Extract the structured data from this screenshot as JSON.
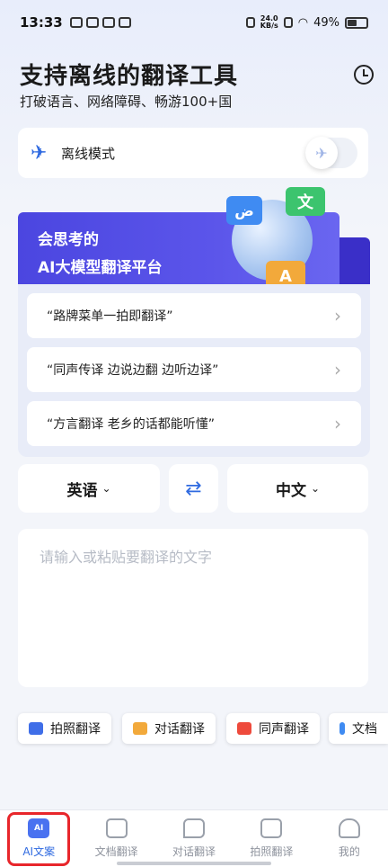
{
  "status": {
    "time": "13:33",
    "net_speed": "24.0\nKB/s",
    "battery": "49%"
  },
  "header": {
    "title": "支持离线的翻译工具",
    "subtitle": "打破语言、网络障碍、畅游100+国"
  },
  "offline": {
    "label": "离线模式"
  },
  "banner": {
    "line1": "会思考的",
    "line2": "AI大模型翻译平台",
    "bubble1": "ض",
    "bubble2": "文",
    "bubble3": "A"
  },
  "suggestions": [
    {
      "text": "“路牌菜单一拍即翻译”"
    },
    {
      "text": "“同声传译 边说边翻 边听边译”"
    },
    {
      "text": "“方言翻译 老乡的话都能听懂”"
    }
  ],
  "languages": {
    "source": "英语",
    "target": "中文"
  },
  "input": {
    "placeholder": "请输入或粘贴要翻译的文字"
  },
  "chips": [
    {
      "label": "拍照翻译",
      "icon": "camera-icon",
      "color": "#3f6ee8"
    },
    {
      "label": "对话翻译",
      "icon": "chat-icon",
      "color": "#f2a93b"
    },
    {
      "label": "同声翻译",
      "icon": "speaker-icon",
      "color": "#ee4a3c"
    },
    {
      "label": "文档",
      "icon": "folder-icon",
      "color": "#3f8bf2"
    }
  ],
  "nav": [
    {
      "label": "AI文案",
      "icon": "ai-doc-icon",
      "active": true
    },
    {
      "label": "文档翻译",
      "icon": "folder-icon",
      "active": false
    },
    {
      "label": "对话翻译",
      "icon": "chat-icon",
      "active": false
    },
    {
      "label": "拍照翻译",
      "icon": "camera-icon",
      "active": false
    },
    {
      "label": "我的",
      "icon": "profile-icon",
      "active": false
    }
  ],
  "colors": {
    "accent": "#2f6ae0",
    "banner": "#4b46e0",
    "highlight": "#e8262b"
  }
}
